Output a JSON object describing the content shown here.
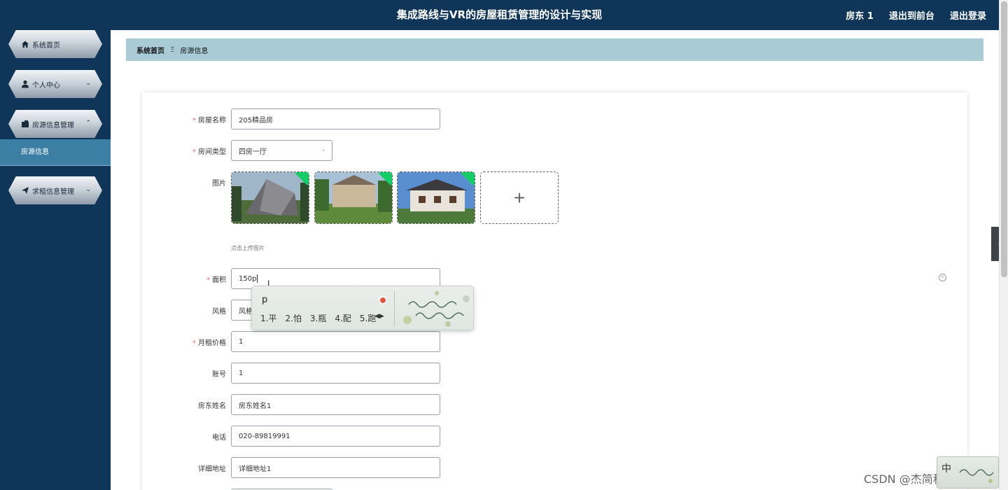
{
  "header": {
    "title": "集成路线与VR的房屋租赁管理的设计与实现",
    "user": "房东 1",
    "back_to_front": "退出到前台",
    "logout": "退出登录"
  },
  "sidebar": {
    "items": [
      {
        "label": "系统首页",
        "icon": "home-icon"
      },
      {
        "label": "个人中心",
        "icon": "user-icon"
      },
      {
        "label": "房源信息管理",
        "icon": "folder-icon"
      },
      {
        "label": "求租信息管理",
        "icon": "send-icon"
      }
    ],
    "active_sub": "房源信息"
  },
  "breadcrumb": {
    "home": "系统首页",
    "separator": "Ξ",
    "current": "房源信息"
  },
  "form": {
    "name_label": "房屋名称",
    "name_value": "205精品房",
    "type_label": "房间类型",
    "type_value": "四房一厅",
    "pic_label": "图片",
    "upload_tip": "点击上传图片",
    "area_label": "面积",
    "area_value": "150p",
    "style_label": "风格",
    "style_value": "风格",
    "rent_label": "月租价格",
    "rent_value": "1",
    "account_label": "账号",
    "account_value": "1",
    "owner_label": "房东姓名",
    "owner_value": "房东姓名1",
    "phone_label": "电话",
    "phone_value": "020-89819991",
    "address_label": "详细地址",
    "address_value": "详细地址1"
  },
  "ime": {
    "typed": "p",
    "candidates": [
      "1.平",
      "2.怕",
      "3.瓶",
      "4.配",
      "5.跑"
    ],
    "mini_label": "中"
  },
  "watermark": "CSDN @杰简程序毕设",
  "colors": {
    "header_bg": "#0f3559",
    "sidebar_bg": "#0f3559",
    "breadcrumb_bg": "#a8cbd6",
    "active_sub_bg": "#3c7fa4",
    "required": "#f56c6c"
  }
}
